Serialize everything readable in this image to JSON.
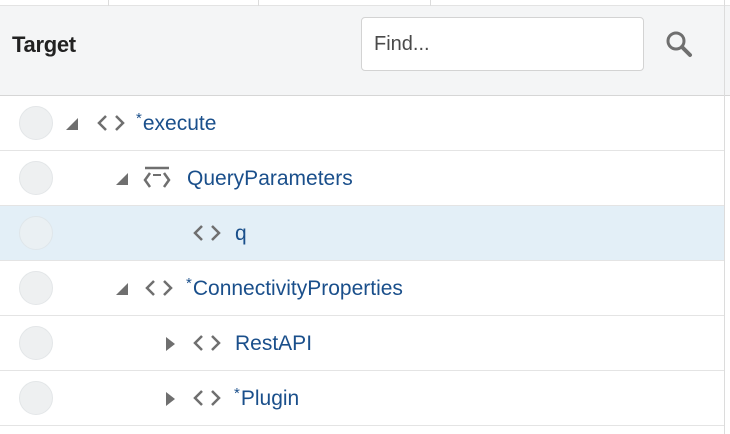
{
  "header": {
    "title": "Target",
    "search": {
      "placeholder": "Find...",
      "value": ""
    }
  },
  "tree": {
    "rows": [
      {
        "required": "*",
        "label": "execute",
        "icon": "element-icon",
        "toggle": "expanded"
      },
      {
        "required": "",
        "label": "QueryParameters",
        "icon": "group-icon",
        "toggle": "expanded"
      },
      {
        "required": "",
        "label": "q",
        "icon": "element-icon",
        "toggle": "none",
        "selected": true
      },
      {
        "required": "*",
        "label": "ConnectivityProperties",
        "icon": "element-icon",
        "toggle": "expanded"
      },
      {
        "required": "",
        "label": "RestAPI",
        "icon": "element-icon",
        "toggle": "collapsed"
      },
      {
        "required": "*",
        "label": "Plugin",
        "icon": "element-icon",
        "toggle": "collapsed"
      }
    ]
  },
  "colors": {
    "header_bg": "#f4f5f6",
    "selected_row": "#e3eff7",
    "link_text": "#1a4f8b",
    "icon_gray": "#6f6f6f"
  }
}
